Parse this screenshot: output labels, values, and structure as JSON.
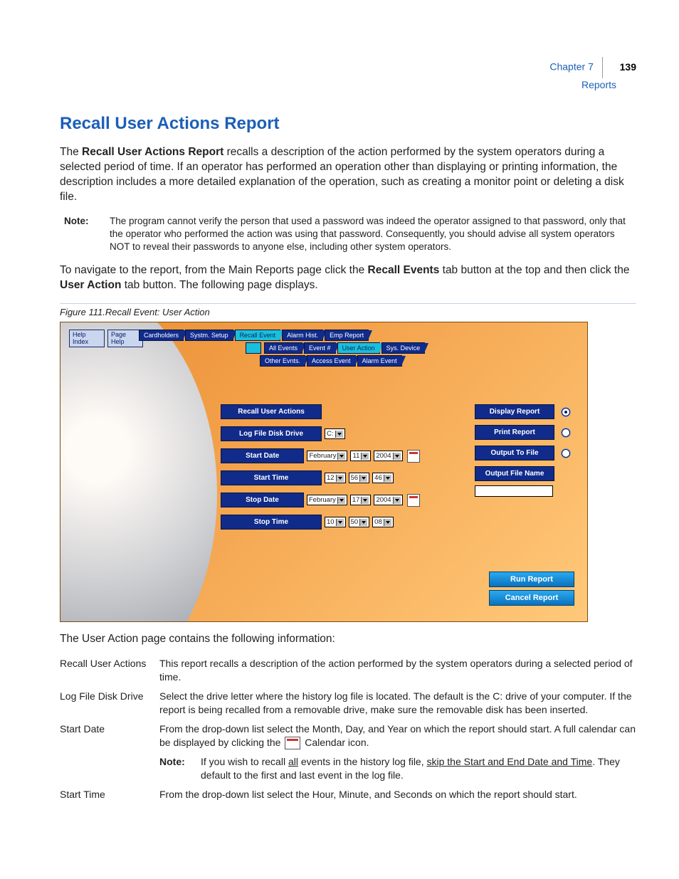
{
  "header": {
    "chapter": "Chapter 7",
    "section": "Reports",
    "page": "139"
  },
  "title": "Recall User Actions Report",
  "para1_prefix": "The ",
  "para1_bold": "Recall User Actions Report",
  "para1_suffix": " recalls a description of the action performed by the system operators during a selected period of time. If an operator has performed an operation other than displaying or printing information, the description includes a more detailed explanation of the operation, such as creating a monitor point or deleting a disk file.",
  "note_label": "Note:",
  "note_text": "The program cannot verify the person that used a password was indeed the operator assigned to that password, only that the operator who performed the action was using that password. Consequently, you should advise all system operators NOT to reveal their passwords to anyone else, including other system operators.",
  "para2_a": "To navigate to the report, from the Main Reports page click the ",
  "para2_b": "Recall Events",
  "para2_c": " tab button at the top and then click the ",
  "para2_d": "User Action",
  "para2_e": " tab button. The following page displays.",
  "fig_caption": "Figure 111.Recall Event: User Action",
  "shot": {
    "help_index": "Help\nIndex",
    "page_help": "Page\nHelp",
    "tabs_row1": [
      "Cardholders",
      "Systm. Setup",
      "Recall Event",
      "Alarm Hist.",
      "Emp Report"
    ],
    "tabs_row1_active_index": 2,
    "tabs_row2": [
      "All Events",
      "Event #",
      "User Action",
      "Sys. Device"
    ],
    "tabs_row2_active_index": 2,
    "tabs_row3": [
      "Other Evnts.",
      "Access Event",
      "Alarm Event"
    ],
    "form_labels": [
      "Recall User Actions",
      "Log File Disk Drive",
      "Start Date",
      "Start Time",
      "Stop Date",
      "Stop Time"
    ],
    "drive": "C:",
    "start_date": {
      "month": "February",
      "day": "11",
      "year": "2004"
    },
    "start_time": {
      "h": "12",
      "m": "56",
      "s": "46"
    },
    "stop_date": {
      "month": "February",
      "day": "17",
      "year": "2004"
    },
    "stop_time": {
      "h": "10",
      "m": "50",
      "s": "08"
    },
    "side": [
      "Display Report",
      "Print Report",
      "Output To File",
      "Output File Name"
    ],
    "side_selected_index": 0,
    "run": "Run Report",
    "cancel": "Cancel Report"
  },
  "after_shot": "The User Action page contains the following information:",
  "defs": [
    {
      "term": "Recall User Actions",
      "desc": "This report recalls a description of the action performed by the system operators during a selected period of time."
    },
    {
      "term": "Log File Disk Drive",
      "desc": "Select the drive letter where the history log file is located. The default is the C: drive of your computer. If the report is being recalled from a removable drive, make sure the removable disk has been inserted."
    }
  ],
  "start_date_term": "Start Date",
  "start_date_desc_a": "From the drop-down list select the Month, Day, and Year on which the report should start. A full calendar can be displayed by clicking the ",
  "start_date_desc_b": " Calendar icon.",
  "start_date_note_label": "Note:",
  "start_date_note_a": "If you wish to recall ",
  "start_date_note_u1": "all",
  "start_date_note_b": " events in the history log file, ",
  "start_date_note_u2": "skip the Start and End Date and Time",
  "start_date_note_c": ". They default to the first and last event in the log file.",
  "start_time_term": "Start Time",
  "start_time_desc": "From the drop-down list select the Hour, Minute, and Seconds on which the report should start."
}
